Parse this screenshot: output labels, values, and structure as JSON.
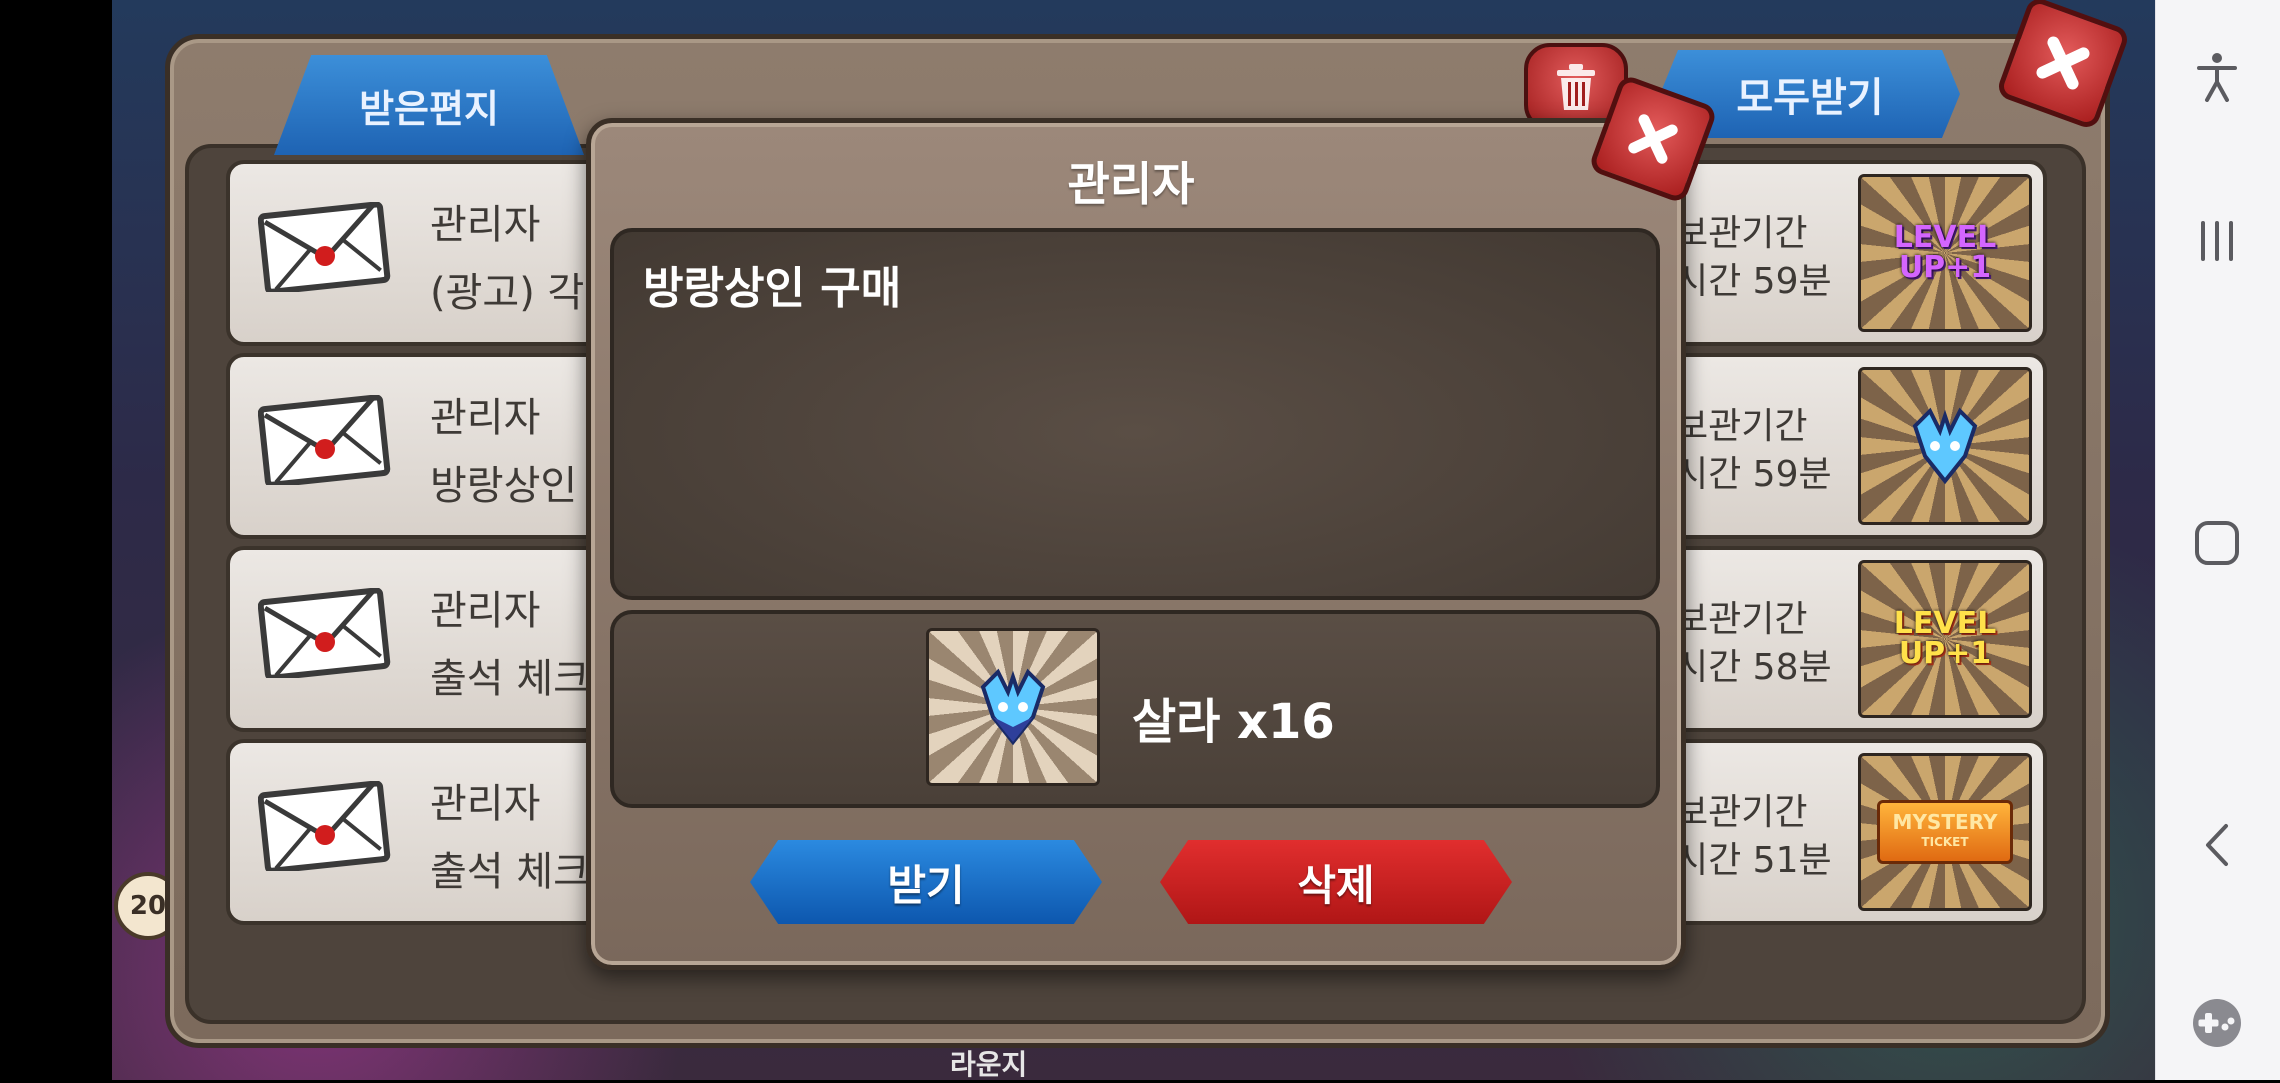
{
  "mailbox": {
    "tab_label": "받은편지",
    "receive_all_label": "모두받기",
    "rows": [
      {
        "sender": "관리자",
        "subject": "(광고) 각",
        "expiry_line1": "보관기간",
        "expiry_line2": "시간 59분",
        "item": "level-up-purple"
      },
      {
        "sender": "관리자",
        "subject": "방랑상인",
        "expiry_line1": "보관기간",
        "expiry_line2": "시간 59분",
        "item": "sala-icon"
      },
      {
        "sender": "관리자",
        "subject": "출석 체크",
        "expiry_line1": "보관기간",
        "expiry_line2": "시간 58분",
        "item": "level-up-yellow"
      },
      {
        "sender": "관리자",
        "subject": "출석 체크",
        "expiry_line1": "보관기간",
        "expiry_line2": "시간 51분",
        "item": "mystery-ticket"
      }
    ],
    "thumb_text": {
      "level_up_line1": "LEVEL",
      "level_up_line2": "UP+1",
      "mystery_line1": "MYSTERY",
      "mystery_line2": "TICKET"
    }
  },
  "modal": {
    "title": "관리자",
    "message": "방랑상인 구매",
    "reward_label": "살라 x16",
    "receive_label": "받기",
    "delete_label": "삭제"
  },
  "background": {
    "bottom_label": "라운지",
    "badge": "20"
  },
  "nav": {
    "icons": [
      "accessibility-icon",
      "recent-apps-icon",
      "home-icon",
      "back-icon",
      "game-tools-icon"
    ]
  },
  "colors": {
    "primary_blue": "#1e63b3",
    "danger_red": "#b01616",
    "panel_brown": "#7c6a5c"
  }
}
